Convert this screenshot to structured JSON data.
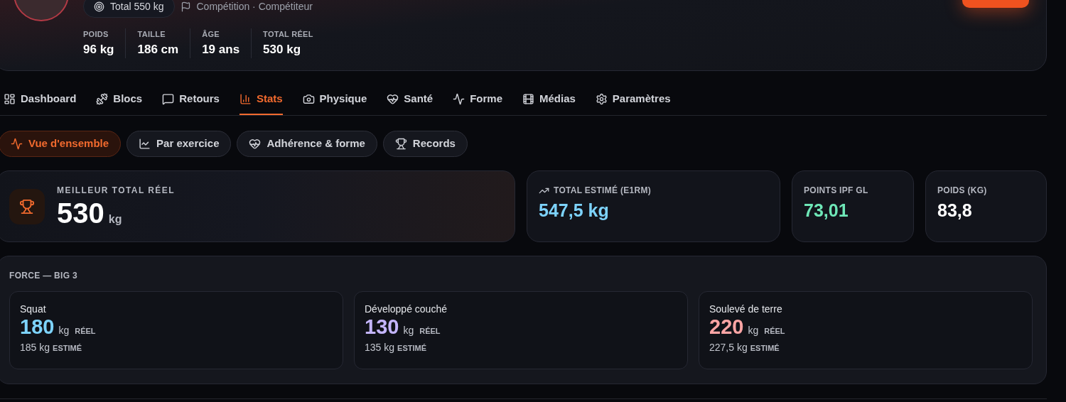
{
  "header": {
    "chip": "Total 550 kg",
    "category": "Compétition · Compétiteur",
    "stats": [
      {
        "label": "POIDS",
        "value": "96 kg"
      },
      {
        "label": "TAILLE",
        "value": "186 cm"
      },
      {
        "label": "ÂGE",
        "value": "19 ans"
      },
      {
        "label": "TOTAL RÉEL",
        "value": "530 kg"
      }
    ]
  },
  "tabs": [
    {
      "label": "Dashboard",
      "selected": false
    },
    {
      "label": "Blocs",
      "selected": false
    },
    {
      "label": "Retours",
      "selected": false
    },
    {
      "label": "Stats",
      "selected": true
    },
    {
      "label": "Physique",
      "selected": false
    },
    {
      "label": "Santé",
      "selected": false
    },
    {
      "label": "Forme",
      "selected": false
    },
    {
      "label": "Médias",
      "selected": false
    },
    {
      "label": "Paramètres",
      "selected": false
    }
  ],
  "subtabs": [
    {
      "label": "Vue d'ensemble",
      "selected": true
    },
    {
      "label": "Par exercice",
      "selected": false
    },
    {
      "label": "Adhérence & forme",
      "selected": false
    },
    {
      "label": "Records",
      "selected": false
    }
  ],
  "hero": {
    "label": "MEILLEUR TOTAL RÉEL",
    "value": "530",
    "unit": "kg"
  },
  "kpis": [
    {
      "label": "TOTAL ESTIMÉ (E1RM)",
      "value": "547,5 kg",
      "color": "#7dd3fc"
    },
    {
      "label": "POINTS IPF GL",
      "value": "73,01",
      "color": "#6ee7b7"
    },
    {
      "label": "POIDS (KG)",
      "value": "83,8",
      "color": "#ffffff"
    }
  ],
  "big3": {
    "title": "FORCE — BIG 3",
    "lifts": [
      {
        "name": "Squat",
        "value": "180",
        "unit": "kg",
        "real_label": "RÉEL",
        "estimate": "185 kg",
        "estimate_label": "ESTIMÉ",
        "color": "#7dd3fc"
      },
      {
        "name": "Développé couché",
        "value": "130",
        "unit": "kg",
        "real_label": "RÉEL",
        "estimate": "135 kg",
        "estimate_label": "ESTIMÉ",
        "color": "#c4b5fd"
      },
      {
        "name": "Soulevé de terre",
        "value": "220",
        "unit": "kg",
        "real_label": "RÉEL",
        "estimate": "227,5 kg",
        "estimate_label": "ESTIMÉ",
        "color": "#fca5a5"
      }
    ]
  }
}
